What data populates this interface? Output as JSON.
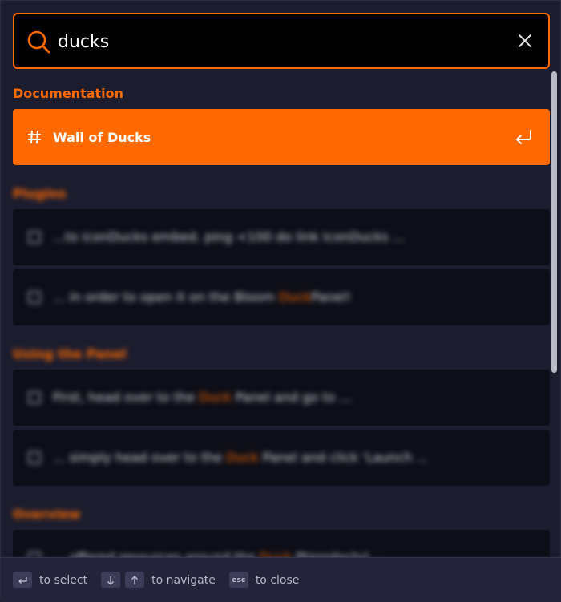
{
  "search": {
    "value": "ducks",
    "icon": "search-icon",
    "clear_icon": "close-icon",
    "accent": "#ff6a00"
  },
  "sections": [
    {
      "title": "Documentation",
      "hits": [
        {
          "prefix": "Wall of ",
          "match": "Ducks",
          "suffix": "",
          "icon": "hash-icon",
          "selected": true
        }
      ]
    },
    {
      "title": "Plugins",
      "hits": [
        {
          "prefix": "...to iconDucks embed. ping <100 do link iconDucks ...",
          "match": "",
          "suffix": "",
          "icon": "text-icon"
        },
        {
          "prefix": "... in order to open it on the Bloom ",
          "match": "Duck",
          "suffix": "Panel!",
          "icon": "text-icon"
        }
      ]
    },
    {
      "title": "Using the Panel",
      "hits": [
        {
          "prefix": "First, head over to the ",
          "match": "Duck",
          "suffix": " Panel and go to ...",
          "icon": "text-icon"
        },
        {
          "prefix": "... simply head over to the ",
          "match": "Duck",
          "suffix": " Panel and click 'Launch ...",
          "icon": "text-icon"
        }
      ]
    },
    {
      "title": "Overview",
      "hits": [
        {
          "prefix": "... offered resources around the ",
          "match": "Duck",
          "suffix": " Pterodactyl ...",
          "icon": "text-icon"
        }
      ]
    }
  ],
  "footer": {
    "select_label": "to select",
    "navigate_label": "to navigate",
    "close_label": "to close",
    "esc_key": "esc"
  }
}
